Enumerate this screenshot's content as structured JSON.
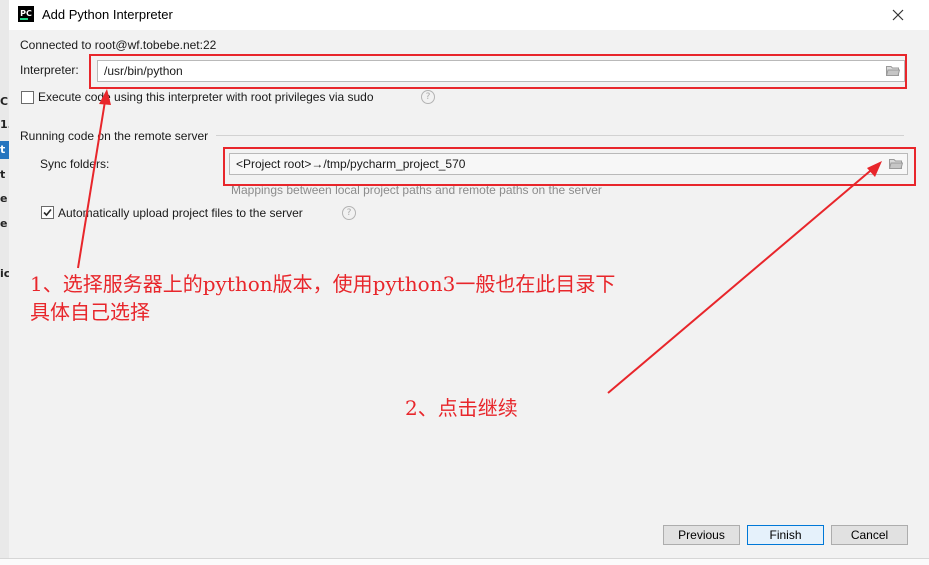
{
  "dialog": {
    "title": "Add Python Interpreter",
    "app_icon_text": "PC",
    "connection": "Connected to root@wf.tobebe.net:22"
  },
  "interpreter": {
    "label": "Interpreter:",
    "value": "/usr/bin/python"
  },
  "sudo": {
    "label": "Execute code using this interpreter with root privileges via sudo",
    "checked": false
  },
  "remote": {
    "section_title": "Running code on the remote server",
    "sync_label": "Sync folders:",
    "sync_value": "<Project root>→/tmp/pycharm_project_570",
    "sync_hint": "Mappings between local project paths and remote paths on the server",
    "auto_upload_label": "Automatically upload project files to the server",
    "auto_upload_checked": true
  },
  "buttons": {
    "previous": "Previous",
    "finish": "Finish",
    "cancel": "Cancel"
  },
  "annotations": {
    "note1_line1": "1、选择服务器上的python版本，使用python3一般也在此目录下",
    "note1_line2": "具体自己选择",
    "note2": "2、点击继续",
    "color": "#e8262b"
  },
  "background": {
    "left_fragments": [
      "C",
      "1.",
      "t",
      "t",
      "e",
      "e",
      "ic"
    ]
  },
  "colors": {
    "dialog_bg": "#f2f2f2",
    "accent": "#0078d7",
    "annotation_red": "#e8262b",
    "selection_blue": "#2675bf"
  }
}
